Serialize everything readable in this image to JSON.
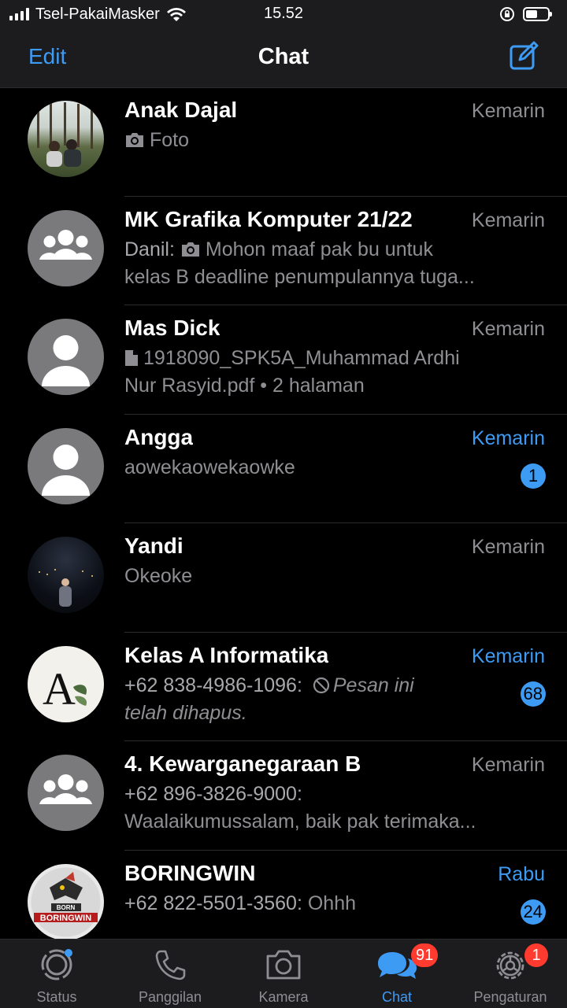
{
  "status_bar": {
    "carrier": "Tsel-PakaiMasker",
    "time": "15.52"
  },
  "nav": {
    "edit_label": "Edit",
    "title": "Chat",
    "compose_icon": "compose-icon"
  },
  "chats": [
    {
      "name": "Anak Dajal",
      "time": "Kemarin",
      "line1": "Foto",
      "icon": "camera-icon",
      "unread": ""
    },
    {
      "name": "MK Grafika Komputer 21/22",
      "time": "Kemarin",
      "sender": "Danil:",
      "line1": "Mohon maaf pak bu untuk",
      "line2": "kelas B deadline penumpulannya tuga...",
      "icon": "camera-icon",
      "unread": ""
    },
    {
      "name": "Mas Dick",
      "time": "Kemarin",
      "line1": "1918090_SPK5A_Muhammad Ardhi",
      "line2": "Nur Rasyid.pdf • 2 halaman",
      "icon": "document-icon",
      "unread": ""
    },
    {
      "name": "Angga",
      "time": "Kemarin",
      "line1": "aowekaowekaowke",
      "unread": "1"
    },
    {
      "name": "Yandi",
      "time": "Kemarin",
      "line1": "Okeoke",
      "unread": ""
    },
    {
      "name": "Kelas A Informatika",
      "time": "Kemarin",
      "sender": "+62 838-4986-1096:",
      "line1": "Pesan ini",
      "line2": "telah dihapus.",
      "icon": "deleted-icon",
      "unread": "68"
    },
    {
      "name": "4. Kewarganegaraan B",
      "time": "Kemarin",
      "sender": "+62 896-3826-9000:",
      "line2": "Waalaikumussalam, baik pak terimaka...",
      "unread": ""
    },
    {
      "name": "BORINGWIN",
      "time": "Rabu",
      "sender": "+62 822-5501-3560:",
      "line1": "Ohhh",
      "unread": "24",
      "logo_text_top": "BORN",
      "logo_text": "BORINGWIN"
    }
  ],
  "avatar_logo_letter": "A",
  "tabs": [
    {
      "label": "Status",
      "icon": "status-icon"
    },
    {
      "label": "Panggilan",
      "icon": "phone-icon"
    },
    {
      "label": "Kamera",
      "icon": "camera-icon"
    },
    {
      "label": "Chat",
      "icon": "chat-icon",
      "badge": "91",
      "active": true
    },
    {
      "label": "Pengaturan",
      "icon": "gear-icon",
      "badge": "1"
    }
  ],
  "colors": {
    "accent": "#3e9bf4",
    "badge_red": "#ff3b30",
    "background": "#000000",
    "bar": "#1c1c1e",
    "secondary_text": "#8e8e93"
  }
}
